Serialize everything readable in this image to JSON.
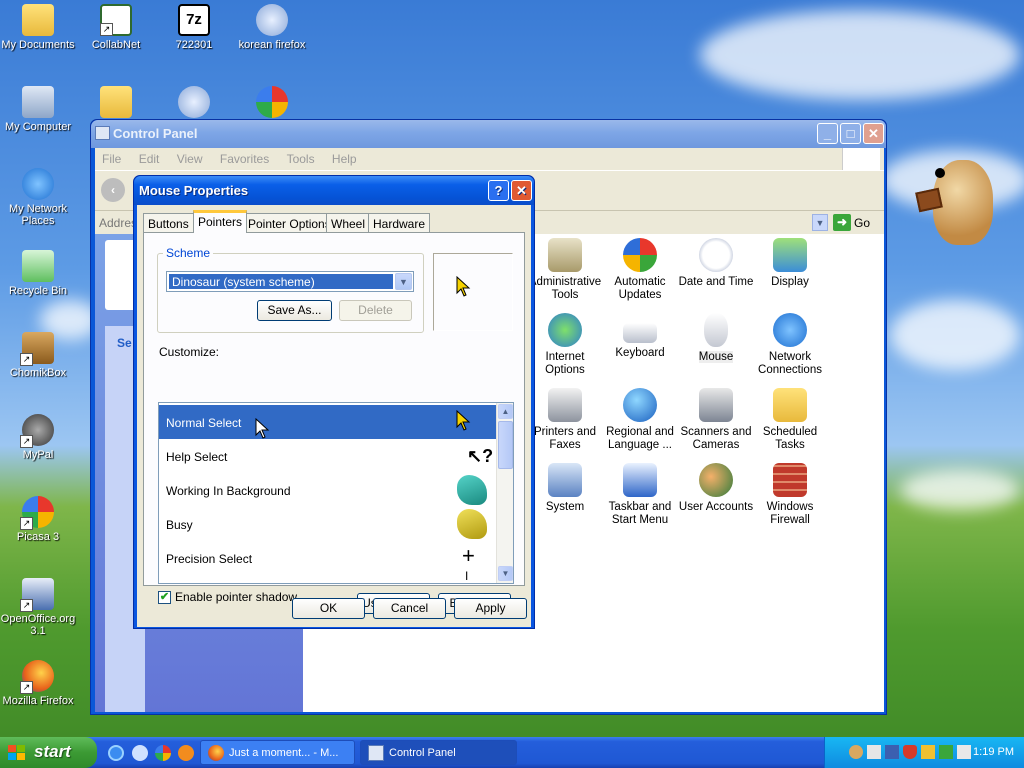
{
  "desktop_icons": [
    {
      "label": "My Documents",
      "icon": "folder-documents-icon"
    },
    {
      "label": "CollabNet",
      "icon": "certificate-icon"
    },
    {
      "label": "722301",
      "icon": "7zip-icon"
    },
    {
      "label": "korean firefox",
      "icon": "cd-installer-icon"
    },
    {
      "label": "My Computer",
      "icon": "computer-icon"
    },
    {
      "label": "My Network Places",
      "icon": "network-icon"
    },
    {
      "label": "Recycle Bin",
      "icon": "recycle-bin-icon"
    },
    {
      "label": "ChomikBox",
      "icon": "chomikbox-icon"
    },
    {
      "label": "MyPal",
      "icon": "raccoon-icon"
    },
    {
      "label": "Picasa 3",
      "icon": "picasa-icon"
    },
    {
      "label": "OpenOffice.org 3.1",
      "icon": "openoffice-icon"
    },
    {
      "label": "Mozilla Firefox",
      "icon": "firefox-icon"
    }
  ],
  "control_panel": {
    "title": "Control Panel",
    "menu": [
      "File",
      "Edit",
      "View",
      "Favorites",
      "Tools",
      "Help"
    ],
    "address_label": "Addres",
    "go_label": "Go",
    "items": [
      {
        "label": "Administrative Tools",
        "icon": "administrative-tools-icon"
      },
      {
        "label": "Automatic Updates",
        "icon": "automatic-updates-icon"
      },
      {
        "label": "Date and Time",
        "icon": "date-time-icon"
      },
      {
        "label": "Display",
        "icon": "display-icon"
      },
      {
        "label": "Internet Options",
        "icon": "internet-options-icon"
      },
      {
        "label": "Keyboard",
        "icon": "keyboard-icon"
      },
      {
        "label": "Mouse",
        "icon": "mouse-icon"
      },
      {
        "label": "Network Connections",
        "icon": "network-connections-icon"
      },
      {
        "label": "Printers and Faxes",
        "icon": "printer-icon"
      },
      {
        "label": "Regional and Language ...",
        "icon": "globe-icon"
      },
      {
        "label": "Scanners and Cameras",
        "icon": "scanner-camera-icon"
      },
      {
        "label": "Scheduled Tasks",
        "icon": "scheduled-tasks-icon"
      },
      {
        "label": "System",
        "icon": "system-icon"
      },
      {
        "label": "Taskbar and Start Menu",
        "icon": "taskbar-icon"
      },
      {
        "label": "User Accounts",
        "icon": "user-accounts-icon"
      },
      {
        "label": "Windows Firewall",
        "icon": "firewall-icon"
      }
    ],
    "left_pane_heading": "Se"
  },
  "mouse_properties": {
    "title": "Mouse Properties",
    "help_button": "?",
    "close_button": "✕",
    "tabs": [
      "Buttons",
      "Pointers",
      "Pointer Options",
      "Wheel",
      "Hardware"
    ],
    "active_tab": "Pointers",
    "scheme_label": "Scheme",
    "scheme_value": "Dinosaur (system scheme)",
    "save_as": "Save As...",
    "delete": "Delete",
    "customize_label": "Customize:",
    "pointers": [
      {
        "name": "Normal Select",
        "icon": "arrow-cursor-icon"
      },
      {
        "name": "Help Select",
        "icon": "help-cursor-icon"
      },
      {
        "name": "Working In Background",
        "icon": "dinosaur-working-icon"
      },
      {
        "name": "Busy",
        "icon": "dinosaur-busy-icon"
      },
      {
        "name": "Precision Select",
        "icon": "crosshair-cursor-icon"
      }
    ],
    "selected_pointer": "Normal Select",
    "shadow_label": "Enable pointer shadow",
    "shadow_checked": true,
    "use_default": "Use Default",
    "browse": "Browse...",
    "ok": "OK",
    "cancel": "Cancel",
    "apply": "Apply"
  },
  "taskbar": {
    "start_label": "start",
    "tasks": [
      {
        "label": "Just a moment... - M...",
        "icon": "firefox-icon"
      },
      {
        "label": "Control Panel",
        "icon": "control-panel-icon"
      }
    ],
    "clock": "1:19 PM"
  }
}
